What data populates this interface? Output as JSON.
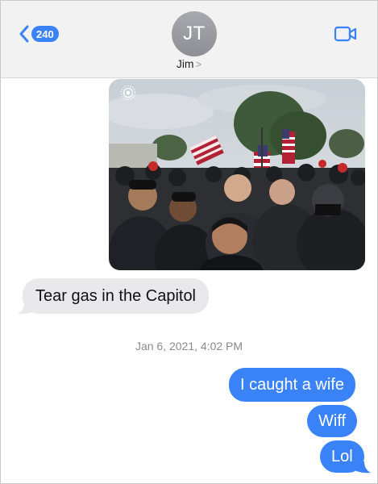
{
  "header": {
    "back_count": "240",
    "avatar_initials": "JT",
    "contact_name": "Jim",
    "contact_chevron": ">",
    "accent_color": "#3a82f7"
  },
  "messages": [
    {
      "direction": "incoming",
      "text": "Tear gas in the Capitol"
    },
    {
      "direction": "outgoing",
      "text": "I caught a wife"
    },
    {
      "direction": "outgoing",
      "text": "Wiff"
    },
    {
      "direction": "outgoing",
      "text": "Lol"
    }
  ],
  "timestamp": "Jan 6, 2021, 4:02 PM",
  "photo": {
    "kind": "crowd photo with American flags outside building",
    "live_icon": "live-photo-icon"
  }
}
